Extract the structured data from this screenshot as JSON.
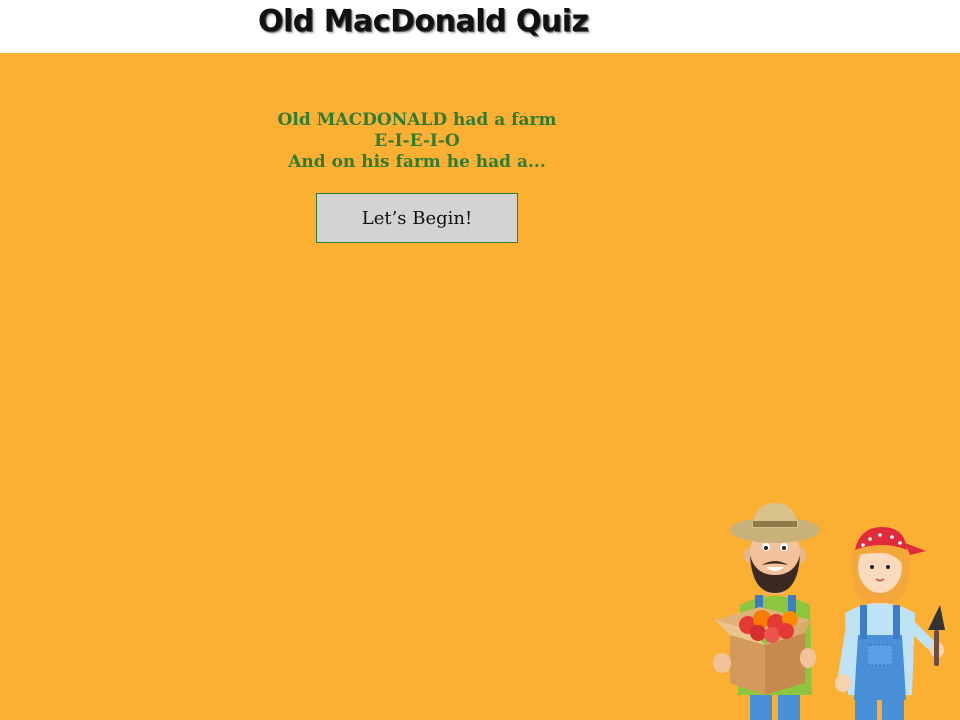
{
  "header": {
    "title": "Old MacDonald Quiz"
  },
  "intro": {
    "line1": "Old MACDONALD had a farm",
    "line2": "E-I-E-I-O",
    "line3": "And on his farm he had a..."
  },
  "start_button": {
    "label": "Let’s Begin!"
  },
  "illustration": {
    "icon": "farmers-illustration"
  },
  "colors": {
    "background": "#FBB034",
    "header_background": "#FFFFFF",
    "intro_text": "#2E7D32",
    "button_background": "#D3D3D3"
  }
}
